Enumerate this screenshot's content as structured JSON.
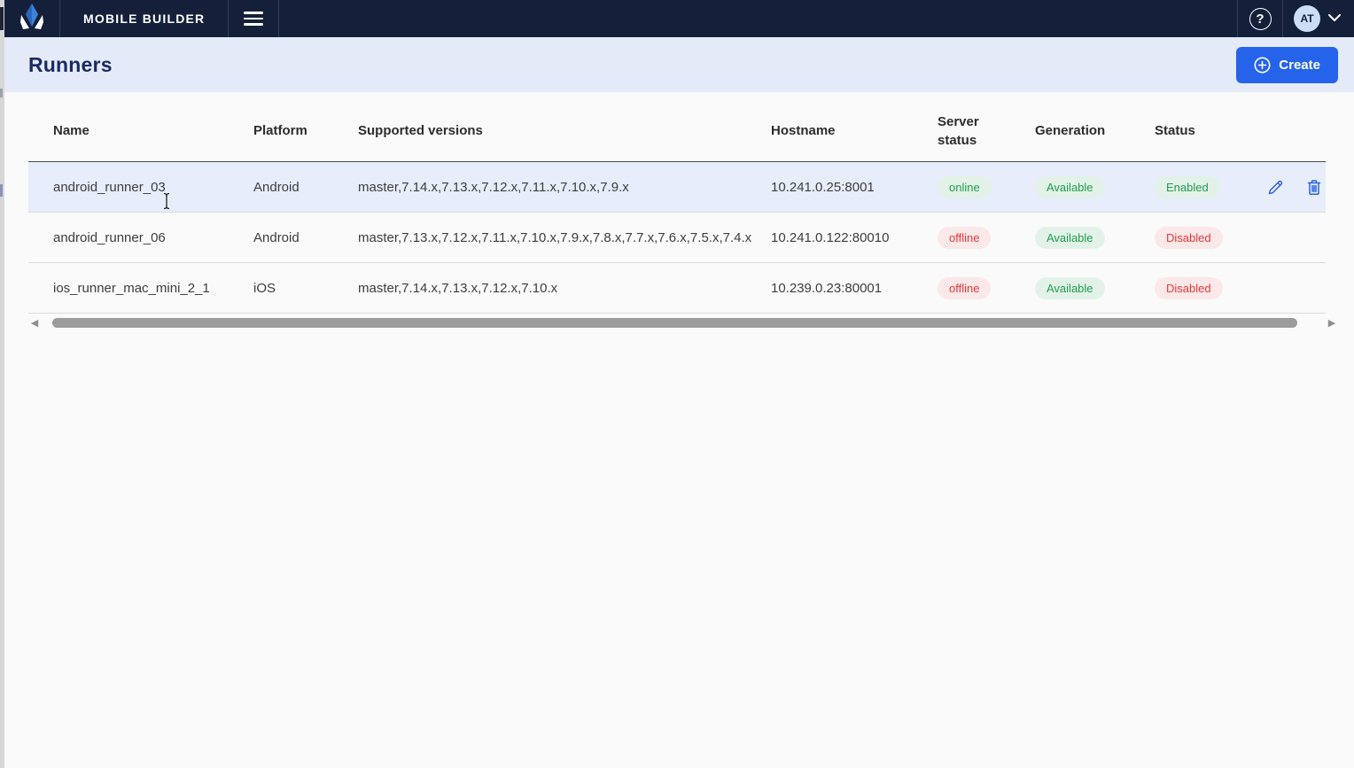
{
  "navbar": {
    "brand": "MOBILE BUILDER",
    "avatar_initials": "AT",
    "bg_color": "#14203a"
  },
  "header": {
    "title": "Runners",
    "create_label": "Create",
    "accent_color": "#2563eb",
    "band_color": "#e4eaf7"
  },
  "table": {
    "columns": {
      "name": "Name",
      "platform": "Platform",
      "versions": "Supported versions",
      "hostname": "Hostname",
      "server_status": "Server status",
      "generation": "Generation",
      "status": "Status"
    },
    "rows": [
      {
        "name": "android_runner_03",
        "platform": "Android",
        "versions": "master,7.14.x,7.13.x,7.12.x,7.11.x,7.10.x,7.9.x",
        "hostname": "10.241.0.25:8001",
        "server_status": "online",
        "generation": "Available",
        "status": "Enabled"
      },
      {
        "name": "android_runner_06",
        "platform": "Android",
        "versions": "master,7.13.x,7.12.x,7.11.x,7.10.x,7.9.x,7.8.x,7.7.x,7.6.x,7.5.x,7.4.x",
        "hostname": "10.241.0.122:80010",
        "server_status": "offline",
        "generation": "Available",
        "status": "Disabled"
      },
      {
        "name": "ios_runner_mac_mini_2_1",
        "platform": "iOS",
        "versions": "master,7.14.x,7.13.x,7.12.x,7.10.x",
        "hostname": "10.239.0.23:80001",
        "server_status": "offline",
        "generation": "Available",
        "status": "Disabled"
      }
    ],
    "status_colors": {
      "positive_text": "#1f9d4d",
      "positive_bg": "#e3f2e8",
      "negative_text": "#e03a3a",
      "negative_bg": "#fbe8e8"
    }
  }
}
